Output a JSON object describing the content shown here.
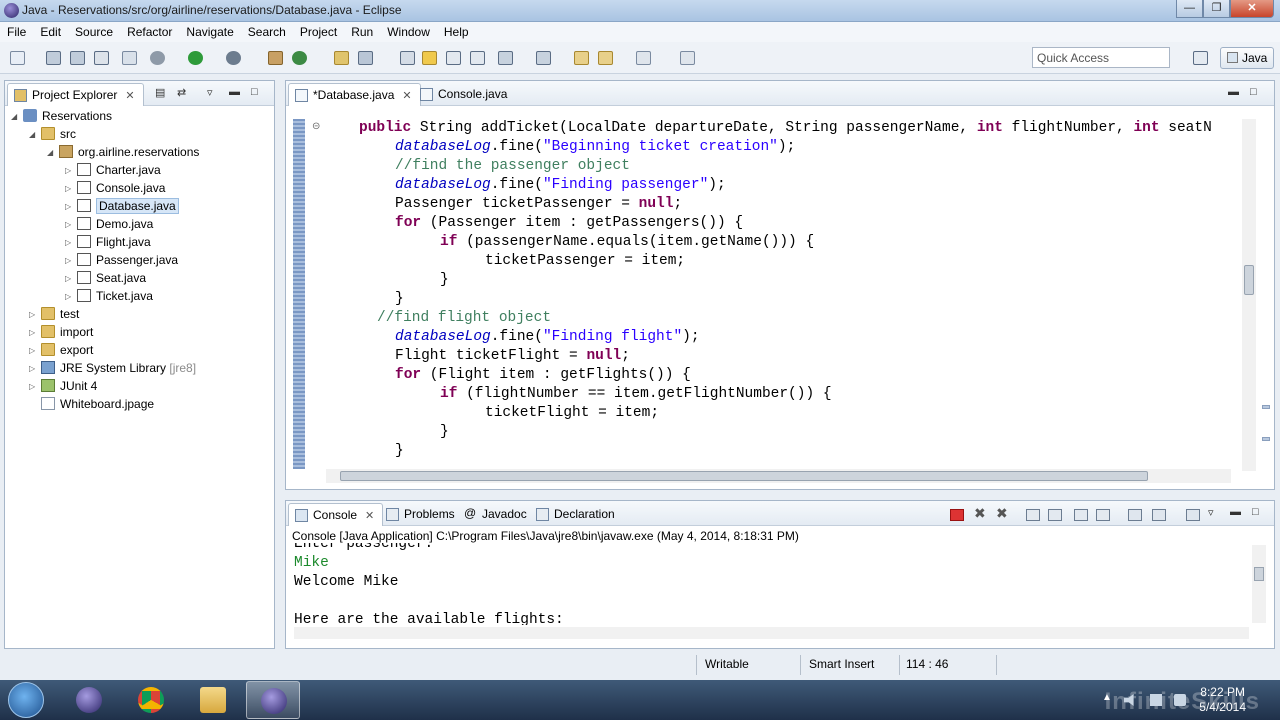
{
  "window": {
    "title": "Java - Reservations/src/org/airline/reservations/Database.java - Eclipse"
  },
  "menu": [
    "File",
    "Edit",
    "Source",
    "Refactor",
    "Navigate",
    "Search",
    "Project",
    "Run",
    "Window",
    "Help"
  ],
  "toolbar": {
    "quick_access_placeholder": "Quick Access",
    "perspective": "Java"
  },
  "explorer": {
    "title": "Project Explorer",
    "tree": [
      {
        "label": "Reservations",
        "kind": "project",
        "expanded": true
      },
      {
        "label": "src",
        "kind": "folder",
        "expanded": true
      },
      {
        "label": "org.airline.reservations",
        "kind": "package",
        "expanded": true
      },
      {
        "label": "Charter.java",
        "kind": "java"
      },
      {
        "label": "Console.java",
        "kind": "java"
      },
      {
        "label": "Database.java",
        "kind": "java",
        "selected": true
      },
      {
        "label": "Demo.java",
        "kind": "java"
      },
      {
        "label": "Flight.java",
        "kind": "java"
      },
      {
        "label": "Passenger.java",
        "kind": "java"
      },
      {
        "label": "Seat.java",
        "kind": "java"
      },
      {
        "label": "Ticket.java",
        "kind": "java"
      },
      {
        "label": "test",
        "kind": "folder"
      },
      {
        "label": "import",
        "kind": "folder"
      },
      {
        "label": "export",
        "kind": "folder"
      },
      {
        "label": "JRE System Library",
        "suffix": "[jre8]",
        "kind": "library"
      },
      {
        "label": "JUnit 4",
        "kind": "library"
      },
      {
        "label": "Whiteboard.jpage",
        "kind": "page"
      }
    ]
  },
  "editor": {
    "tabs": [
      {
        "label": "*Database.java",
        "active": true
      },
      {
        "label": "Console.java",
        "active": false
      }
    ],
    "code": [
      "public String addTicket(LocalDate departureDate, String passengerName, int flightNumber, int seatN",
      "    databaseLog.fine(\"Beginning ticket creation\");",
      "    //find the passenger object",
      "    databaseLog.fine(\"Finding passenger\");",
      "    Passenger ticketPassenger = null;",
      "    for (Passenger item : getPassengers()) {",
      "         if (passengerName.equals(item.getName())) {",
      "              ticketPassenger = item;",
      "         }",
      "    }",
      "  //find flight object",
      "    databaseLog.fine(\"Finding flight\");",
      "    Flight ticketFlight = null;",
      "    for (Flight item : getFlights()) {",
      "         if (flightNumber == item.getFlightNumber()) {",
      "              ticketFlight = item;",
      "         }",
      "    }"
    ]
  },
  "console": {
    "tabs": [
      "Console",
      "Problems",
      "Javadoc",
      "Declaration"
    ],
    "header": "Console [Java Application] C:\\Program Files\\Java\\jre8\\bin\\javaw.exe (May 4, 2014, 8:18:31 PM)",
    "output": [
      {
        "text": "Enter passenger:",
        "color": "#000000"
      },
      {
        "text": "Mike",
        "color": "#1c8a2c"
      },
      {
        "text": "Welcome Mike",
        "color": "#000000"
      },
      {
        "text": "",
        "color": "#000000"
      },
      {
        "text": "Here are the available flights:",
        "color": "#000000"
      }
    ]
  },
  "status": {
    "mode": "Writable",
    "insert": "Smart Insert",
    "position": "114 : 46"
  },
  "taskbar": {
    "time": "8:22 PM",
    "date": "5/4/2014",
    "watermark": "InfiniteSkills"
  },
  "colors": {
    "keyword": "#7f0055",
    "string": "#2a00ff",
    "comment": "#3f7f5f",
    "field": "#0000c0"
  }
}
